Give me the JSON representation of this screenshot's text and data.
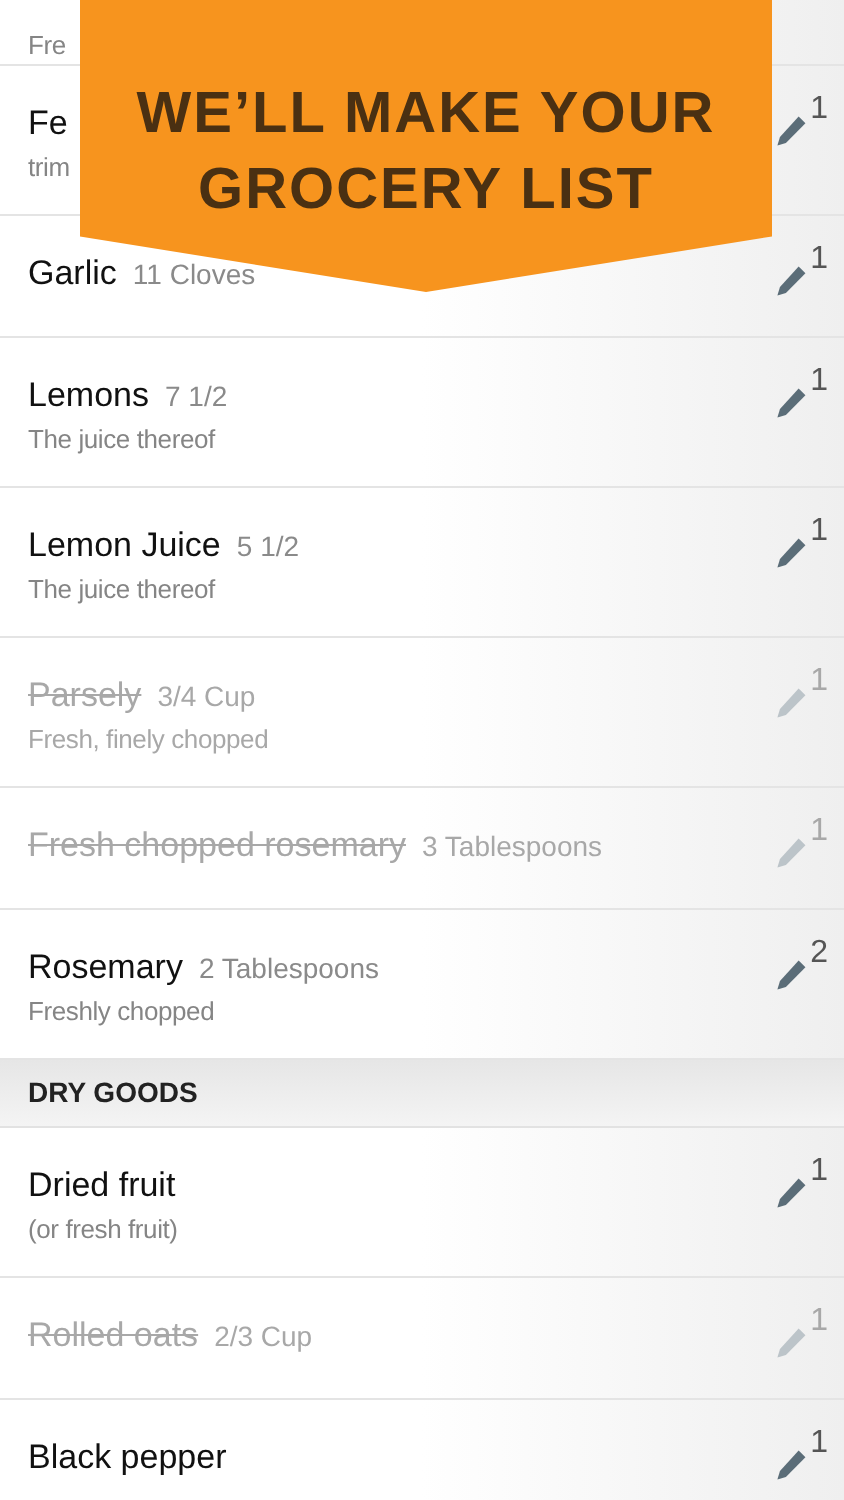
{
  "banner": {
    "lines": [
      "WE’LL MAKE YOUR",
      "GROCERY LIST"
    ]
  },
  "items": [
    {
      "kind": "item",
      "subtitle": "Fre",
      "checked": false
    },
    {
      "kind": "item",
      "name": "Fe",
      "subtitle": "trim",
      "count": "1",
      "checked": false
    },
    {
      "kind": "item",
      "name": "Garlic",
      "quantity": "11 Cloves",
      "count": "1",
      "checked": false
    },
    {
      "kind": "item",
      "name": "Lemons",
      "quantity": "7 1/2",
      "subtitle": "The juice thereof",
      "count": "1",
      "checked": false
    },
    {
      "kind": "item",
      "name": "Lemon Juice",
      "quantity": "5 1/2",
      "subtitle": "The juice thereof",
      "count": "1",
      "checked": false
    },
    {
      "kind": "item",
      "name": "Parsely",
      "quantity": "3/4 Cup",
      "subtitle": "Fresh, finely chopped",
      "count": "1",
      "checked": true
    },
    {
      "kind": "item",
      "name": "Fresh chopped rosemary",
      "quantity": "3 Tablespoons",
      "count": "1",
      "checked": true
    },
    {
      "kind": "item",
      "name": "Rosemary",
      "quantity": "2 Tablespoons",
      "subtitle": "Freshly chopped",
      "count": "2",
      "checked": false
    },
    {
      "kind": "section",
      "title": "DRY GOODS"
    },
    {
      "kind": "item",
      "name": "Dried fruit",
      "subtitle": "(or fresh fruit)",
      "count": "1",
      "checked": false
    },
    {
      "kind": "item",
      "name": "Rolled oats",
      "quantity": "2/3 Cup",
      "count": "1",
      "checked": true
    },
    {
      "kind": "item",
      "name": "Black pepper",
      "count": "1",
      "checked": false
    }
  ]
}
